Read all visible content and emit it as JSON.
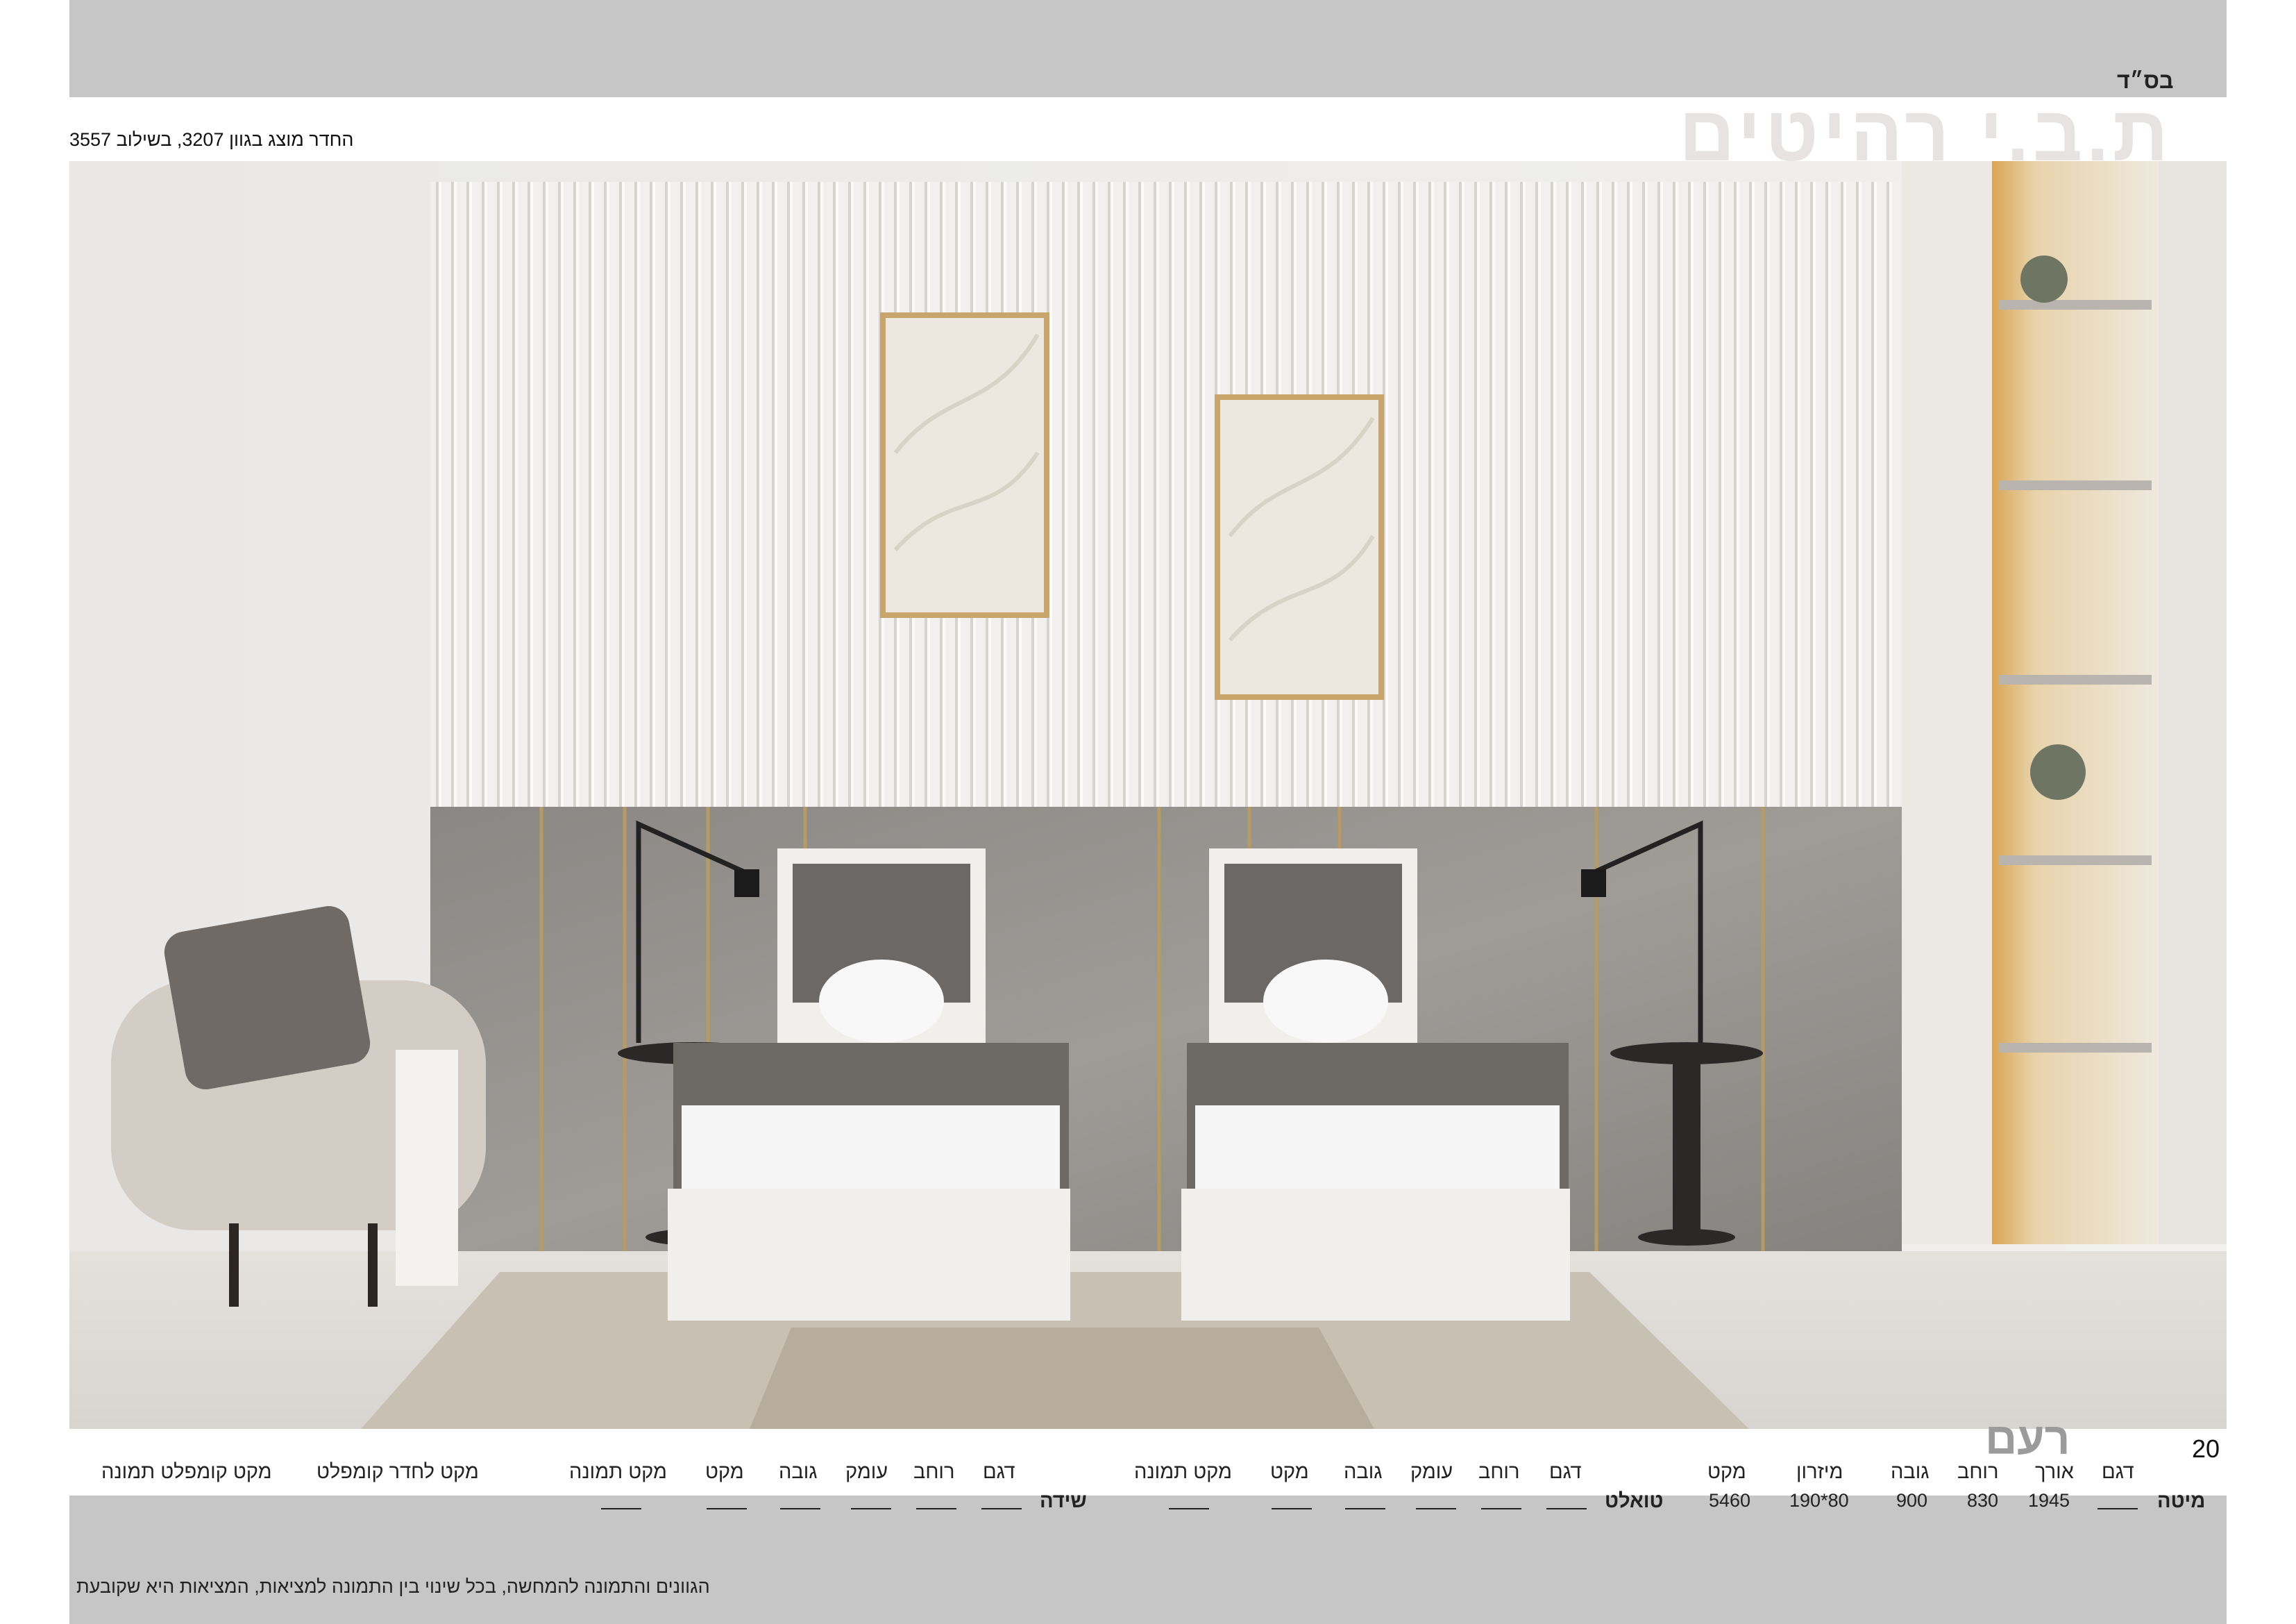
{
  "header": {
    "besd": "בס״ד",
    "brand": "ת.ב.י רהיטים",
    "room_note": "החדר מוצג בגוון 3207, בשילוב 3557"
  },
  "image": {
    "description_icon": "twin-bedroom-photo"
  },
  "collection": {
    "name": "רעם",
    "page_number": "20"
  },
  "colors": {
    "band": "#c6c6c6",
    "brand": "#e6e3e2",
    "collection": "#9b9b9b"
  },
  "spec": {
    "bed": {
      "title": "מיטה",
      "headers": [
        "דגם",
        "אורך",
        "רוחב",
        "גובה",
        "מיזרון",
        "מקט"
      ],
      "values": [
        "1945",
        "830",
        "900",
        "80*190",
        "5460"
      ]
    },
    "toilet": {
      "title": "טואלט",
      "headers": [
        "דגם",
        "רוחב",
        "עומק",
        "גובה",
        "מקט",
        "מקט תמונה"
      ]
    },
    "dresser": {
      "title": "שידה",
      "headers": [
        "דגם",
        "רוחב",
        "עומק",
        "גובה",
        "מקט",
        "מקט תמונה"
      ]
    },
    "compact": {
      "headers": [
        "מקט לחדר קומפלט",
        "מקט קומפלט תמונה"
      ]
    }
  },
  "footer": {
    "disclaimer": "הגוונים והתמונה להמחשה, בכל שינוי בין התמונה למציאות, המציאות היא שקובעת"
  }
}
